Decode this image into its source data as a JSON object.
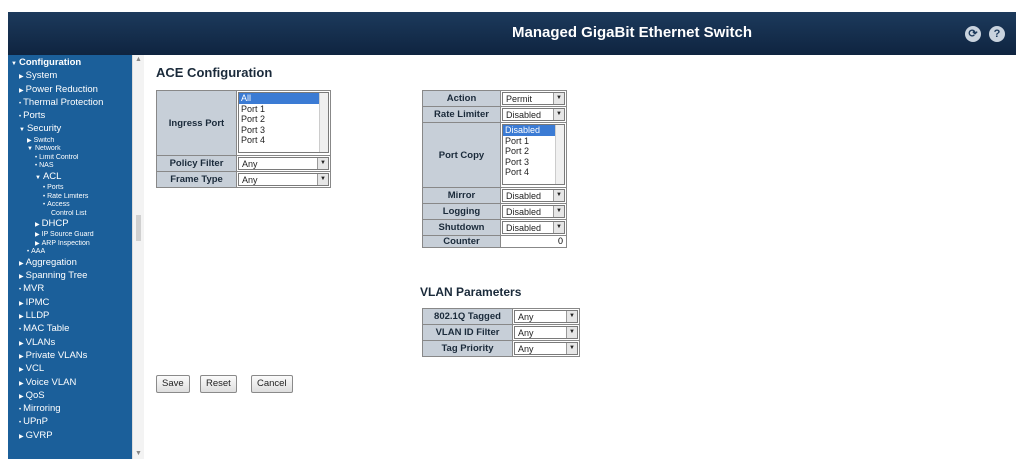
{
  "header": {
    "title": "Managed GigaBit Ethernet Switch"
  },
  "nav": [
    {
      "label": "Configuration",
      "level": 0,
      "arrow": "▼",
      "bold": true
    },
    {
      "label": "System",
      "level": 1,
      "arrow": "▶"
    },
    {
      "label": "Power Reduction",
      "level": 1,
      "arrow": "▶"
    },
    {
      "label": "Thermal Protection",
      "level": 1,
      "arrow": "•"
    },
    {
      "label": "Ports",
      "level": 1,
      "arrow": "•"
    },
    {
      "label": "Security",
      "level": 1,
      "arrow": "▼"
    },
    {
      "label": "Switch",
      "level": 2,
      "arrow": "▶",
      "small": true
    },
    {
      "label": "Network",
      "level": 2,
      "arrow": "▼",
      "small": true
    },
    {
      "label": "Limit Control",
      "level": 3,
      "arrow": "•",
      "small": true
    },
    {
      "label": "NAS",
      "level": 3,
      "arrow": "•",
      "small": true
    },
    {
      "label": "ACL",
      "level": 3,
      "arrow": "▼"
    },
    {
      "label": "Ports",
      "level": 4,
      "arrow": "•",
      "small": true
    },
    {
      "label": "Rate Limiters",
      "level": 4,
      "arrow": "•",
      "small": true
    },
    {
      "label": "Access",
      "level": 4,
      "arrow": "•",
      "small": true
    },
    {
      "label": "Control List",
      "level": 5,
      "arrow": "",
      "small": true
    },
    {
      "label": "DHCP",
      "level": 3,
      "arrow": "▶"
    },
    {
      "label": "IP Source Guard",
      "level": 3,
      "arrow": "▶",
      "small": true
    },
    {
      "label": "ARP Inspection",
      "level": 3,
      "arrow": "▶",
      "small": true
    },
    {
      "label": "AAA",
      "level": 2,
      "arrow": "•",
      "small": true
    },
    {
      "label": "Aggregation",
      "level": 1,
      "arrow": "▶"
    },
    {
      "label": "Spanning Tree",
      "level": 1,
      "arrow": "▶"
    },
    {
      "label": "MVR",
      "level": 1,
      "arrow": "•"
    },
    {
      "label": "IPMC",
      "level": 1,
      "arrow": "▶"
    },
    {
      "label": "LLDP",
      "level": 1,
      "arrow": "▶"
    },
    {
      "label": "MAC Table",
      "level": 1,
      "arrow": "•"
    },
    {
      "label": "VLANs",
      "level": 1,
      "arrow": "▶"
    },
    {
      "label": "Private VLANs",
      "level": 1,
      "arrow": "▶"
    },
    {
      "label": "VCL",
      "level": 1,
      "arrow": "▶"
    },
    {
      "label": "Voice VLAN",
      "level": 1,
      "arrow": "▶"
    },
    {
      "label": "QoS",
      "level": 1,
      "arrow": "▶"
    },
    {
      "label": "Mirroring",
      "level": 1,
      "arrow": "•"
    },
    {
      "label": "UPnP",
      "level": 1,
      "arrow": "•"
    },
    {
      "label": "GVRP",
      "level": 1,
      "arrow": "▶"
    }
  ],
  "main": {
    "title": "ACE Configuration",
    "ingress": {
      "ingress_port_label": "Ingress Port",
      "ingress_port_options": [
        "All",
        "Port 1",
        "Port 2",
        "Port 3",
        "Port 4"
      ],
      "policy_filter_label": "Policy Filter",
      "policy_filter_value": "Any",
      "frame_type_label": "Frame Type",
      "frame_type_value": "Any"
    },
    "action": {
      "action_label": "Action",
      "action_value": "Permit",
      "rate_limiter_label": "Rate Limiter",
      "rate_limiter_value": "Disabled",
      "port_copy_label": "Port Copy",
      "port_copy_options": [
        "Disabled",
        "Port 1",
        "Port 2",
        "Port 3",
        "Port 4"
      ],
      "mirror_label": "Mirror",
      "mirror_value": "Disabled",
      "logging_label": "Logging",
      "logging_value": "Disabled",
      "shutdown_label": "Shutdown",
      "shutdown_value": "Disabled",
      "counter_label": "Counter",
      "counter_value": "0"
    },
    "vlan": {
      "title": "VLAN Parameters",
      "tagged_label": "802.1Q Tagged",
      "tagged_value": "Any",
      "vid_filter_label": "VLAN ID Filter",
      "vid_filter_value": "Any",
      "tag_priority_label": "Tag Priority",
      "tag_priority_value": "Any"
    },
    "buttons": {
      "save": "Save",
      "reset": "Reset",
      "cancel": "Cancel"
    }
  }
}
